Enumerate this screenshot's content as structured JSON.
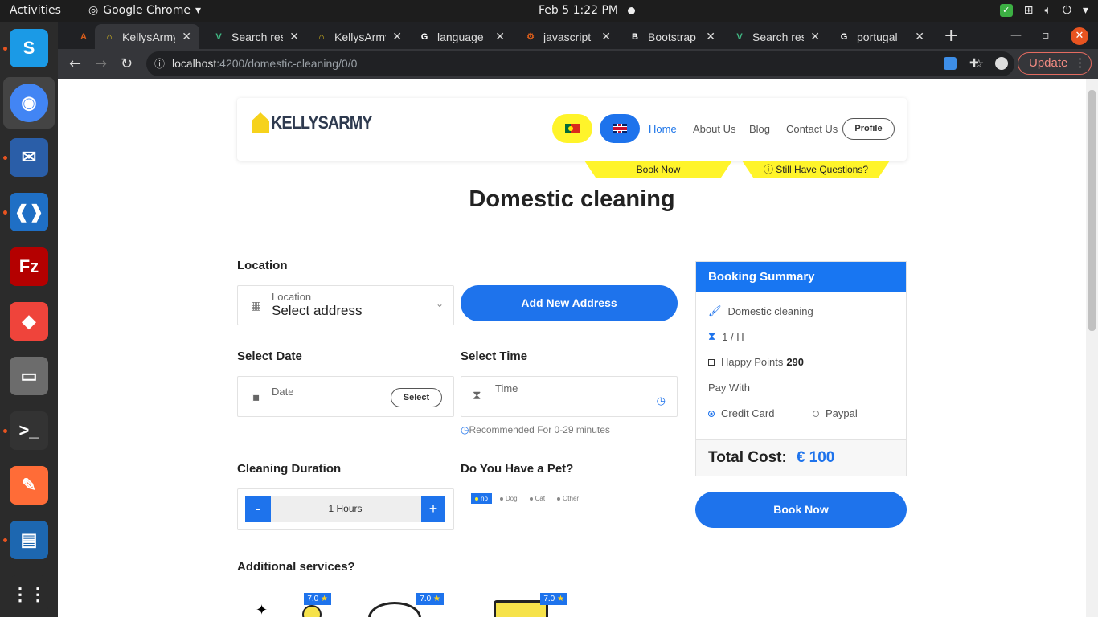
{
  "os": {
    "activities": "Activities",
    "app_menu": "Google Chrome",
    "clock": "Feb 5   1:22 PM"
  },
  "dock": [
    {
      "name": "skype",
      "color": "#1b9ae6",
      "glyph": "S"
    },
    {
      "name": "chrome",
      "color": "#4285f4",
      "glyph": "◉"
    },
    {
      "name": "thunderbird",
      "color": "#2a5ea8",
      "glyph": "✉"
    },
    {
      "name": "vscode",
      "color": "#1f6fc5",
      "glyph": "❰❱"
    },
    {
      "name": "filezilla",
      "color": "#b40000",
      "glyph": "Fz"
    },
    {
      "name": "anydesk",
      "color": "#ef443b",
      "glyph": "◆"
    },
    {
      "name": "files",
      "color": "#6c6c6c",
      "glyph": "▭"
    },
    {
      "name": "terminal",
      "color": "#333333",
      "glyph": ">_"
    },
    {
      "name": "postman",
      "color": "#ff6c37",
      "glyph": "✎"
    },
    {
      "name": "libreoffice-impress",
      "color": "#1d67b0",
      "glyph": "▤"
    },
    {
      "name": "show-apps",
      "color": "#2b2b2b",
      "glyph": "⋮⋮"
    }
  ],
  "tabs": [
    {
      "title": "",
      "icon": "A",
      "color": "#d65c1b"
    },
    {
      "title": "KellysArmy",
      "icon": "⌂",
      "color": "#f6d21c",
      "current": true
    },
    {
      "title": "Search res",
      "icon": "V",
      "color": "#40b883"
    },
    {
      "title": "KellysArmy",
      "icon": "⌂",
      "color": "#f6d21c"
    },
    {
      "title": "language",
      "icon": "G",
      "color": "#ffffff"
    },
    {
      "title": "javascript",
      "icon": "⚙",
      "color": "#d65c1b"
    },
    {
      "title": "Bootstrap",
      "icon": "B",
      "color": "#ffffff"
    },
    {
      "title": "Search res",
      "icon": "V",
      "color": "#40b883"
    },
    {
      "title": "portugal",
      "icon": "G",
      "color": "#ffffff"
    }
  ],
  "browser": {
    "url_host": "localhost",
    "url_path": ":4200/domestic-cleaning/0/0",
    "update_label": "Update"
  },
  "site": {
    "logo_text": "KELLYSARMY",
    "nav": [
      "Home",
      "About Us",
      "Blog",
      "Contact Us"
    ],
    "profile": "Profile",
    "ribbon_book": "Book Now",
    "ribbon_questions": "Still Have Questions?"
  },
  "page": {
    "title": "Domestic cleaning",
    "location_label": "Location",
    "location_field_caption": "Location",
    "location_field_value": "Select address",
    "add_address": "Add New Address",
    "date_label": "Select Date",
    "date_placeholder": "Date",
    "date_select": "Select",
    "time_label": "Select Time",
    "time_placeholder": "Time",
    "time_hint": "Recommended For 0-29 minutes",
    "duration_label": "Cleaning Duration",
    "duration_value": "1 Hours",
    "duration_minus": "-",
    "duration_plus": "+",
    "pet_label": "Do You Have a Pet?",
    "pet_options": [
      "no",
      "Dog",
      "Cat",
      "Other"
    ],
    "additional_label": "Additional services?",
    "service_ratings": [
      "7.0",
      "7.0",
      "7.0"
    ]
  },
  "summary": {
    "title": "Booking Summary",
    "service": "Domestic cleaning",
    "duration": "1 / H",
    "points_label": "Happy Points",
    "points_value": "290",
    "pay_with": "Pay With",
    "credit_card": "Credit Card",
    "paypal": "Paypal",
    "total_label": "Total Cost:",
    "total_value": "€ 100",
    "book_now": "Book Now"
  }
}
